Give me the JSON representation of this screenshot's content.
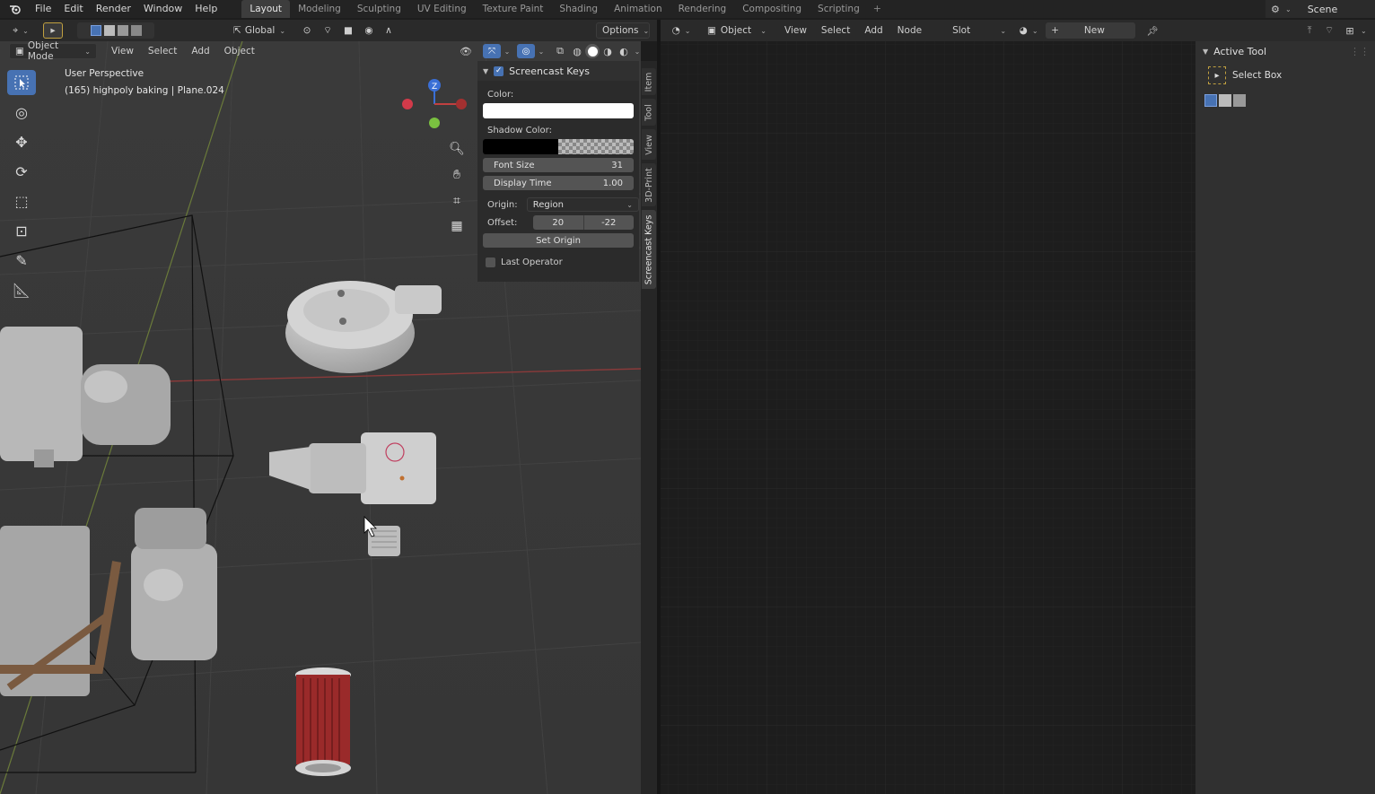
{
  "app": {
    "menu": [
      "File",
      "Edit",
      "Render",
      "Window",
      "Help"
    ],
    "workspaces": [
      "Layout",
      "Modeling",
      "Sculpting",
      "UV Editing",
      "Texture Paint",
      "Shading",
      "Animation",
      "Rendering",
      "Compositing",
      "Scripting"
    ],
    "active_workspace": "Layout",
    "scene_name": "Scene"
  },
  "viewport": {
    "orientation": "Global",
    "options_label": "Options",
    "mode": "Object Mode",
    "menus": [
      "View",
      "Select",
      "Add",
      "Object"
    ],
    "perspective_label": "User Perspective",
    "object_info": "(165) highpoly baking | Plane.024",
    "gizmo_axis_z": "Z",
    "background_color": "#393939",
    "active_tool_color": "#4772b3"
  },
  "npanel": {
    "title": "Screencast Keys",
    "enabled": true,
    "color_label": "Color:",
    "shadow_color_label": "Shadow Color:",
    "font_size_label": "Font Size",
    "font_size_value": "31",
    "display_time_label": "Display Time",
    "display_time_value": "1.00",
    "origin_label": "Origin:",
    "origin_value": "Region",
    "offset_label": "Offset:",
    "offset_x": "20",
    "offset_y": "-22",
    "set_origin_label": "Set Origin",
    "last_operator_label": "Last Operator",
    "last_operator_checked": false,
    "tabs": [
      "Item",
      "Tool",
      "View",
      "3D-Print",
      "Screencast Keys"
    ],
    "active_tab": "Screencast Keys"
  },
  "node_editor": {
    "type_label": "Object",
    "menus": [
      "View",
      "Select",
      "Add",
      "Node"
    ],
    "slot_label": "Slot",
    "new_label": "New",
    "background_color": "#1d1d1d"
  },
  "right_panel": {
    "title": "Active Tool",
    "tool_name": "Select Box"
  }
}
